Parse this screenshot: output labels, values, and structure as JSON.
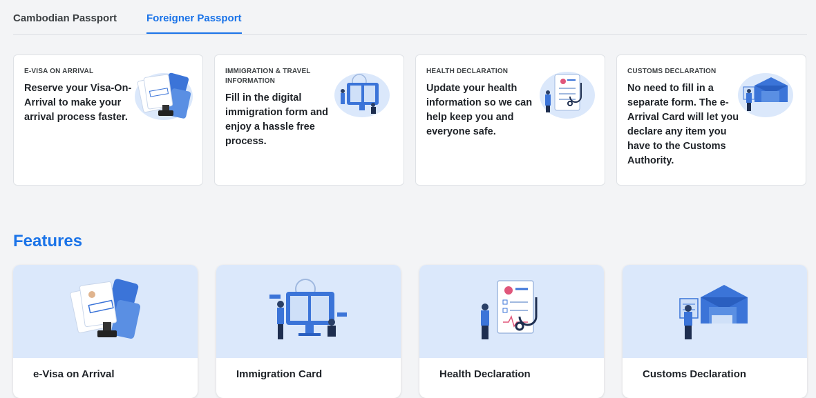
{
  "tabs": [
    {
      "label": "Cambodian Passport",
      "active": false
    },
    {
      "label": "Foreigner Passport",
      "active": true
    }
  ],
  "info_cards": [
    {
      "category": "E-VISA ON ARRIVAL",
      "text_lines": [
        "Reserve your Visa-On-",
        "Arrival to make your",
        "arrival process faster."
      ],
      "icon": "visa-stamp-illustration"
    },
    {
      "category_lines": [
        "IMMIGRATION & TRAVEL",
        "INFORMATION"
      ],
      "text_lines": [
        "Fill in the digital",
        "immigration form and",
        "enjoy a hassle free",
        "process."
      ],
      "icon": "immigration-form-illustration"
    },
    {
      "category": "HEALTH DECLARATION",
      "text_lines": [
        "Update your health",
        "information so we can",
        "help keep you and",
        "everyone safe."
      ],
      "icon": "health-stethoscope-illustration"
    },
    {
      "category": "CUSTOMS DECLARATION",
      "text_lines": [
        "No need to fill in a",
        "separate form. The e-",
        "Arrival Card will let you",
        "declare any item you",
        "have to the Customs",
        "Authority."
      ],
      "icon": "customs-boxes-illustration"
    }
  ],
  "features": {
    "title": "Features",
    "cards": [
      {
        "label": "e-Visa on Arrival",
        "icon": "visa-stamp-illustration"
      },
      {
        "label": "Immigration Card",
        "icon": "immigration-form-illustration"
      },
      {
        "label": "Health Declaration",
        "icon": "health-stethoscope-illustration"
      },
      {
        "label": "Customs Declaration",
        "icon": "customs-boxes-illustration"
      }
    ]
  },
  "colors": {
    "accent": "#1a73e8",
    "illustration_bg": "#dbe8fb",
    "page_bg": "#f3f4f6"
  }
}
